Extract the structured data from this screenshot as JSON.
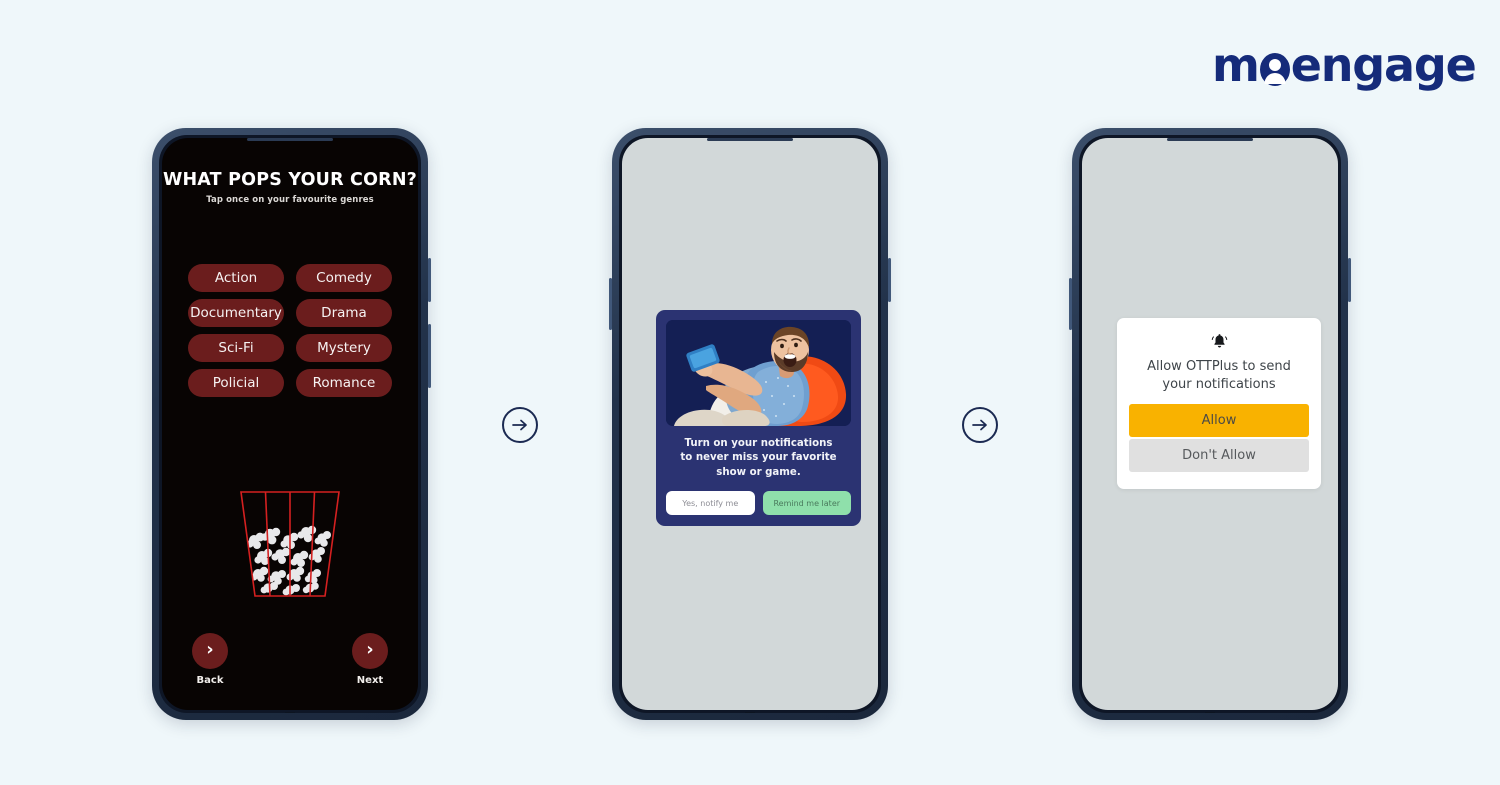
{
  "brand": {
    "logo_text_1": "m",
    "logo_avatar_icon": "person-avatar-o",
    "logo_text_2": "engage",
    "logo_color": "#152b7a",
    "page_background": "#eff7fa"
  },
  "flow": {
    "arrows": [
      {
        "name": "arrow-step-1-to-2",
        "icon": "arrow-right-circle-icon"
      },
      {
        "name": "arrow-step-2-to-3",
        "icon": "arrow-right-circle-icon"
      }
    ]
  },
  "screens": [
    {
      "id": "genre-selection",
      "background": "#080403",
      "title": "WHAT POPS YOUR CORN?",
      "subtitle": "Tap once on your favourite genres",
      "genres": [
        "Action",
        "Comedy",
        "Documentary",
        "Drama",
        "Sci-Fi",
        "Mystery",
        "Policial",
        "Romance"
      ],
      "genre_chip_color": "#6b1d1d",
      "illustration": "popcorn-bucket-illustration",
      "illustration_outline_color": "#d42020",
      "nav": {
        "back_label": "Back",
        "back_icon": "chevron-right-icon",
        "next_label": "Next",
        "next_icon": "chevron-right-icon",
        "circle_color": "#6b1d1d"
      }
    },
    {
      "id": "notification-optin",
      "background": "#d2d8d9",
      "card": {
        "background": "#2b3372",
        "image": "man-on-orange-beanbag-with-phone",
        "image_background": "#141f54",
        "message": "Turn on your notifications to never miss your favorite show or game.",
        "message_lines": [
          "Turn on your notifications",
          "to never miss your favorite",
          "show or game."
        ],
        "buttons": [
          {
            "label": "Yes, notify me",
            "background": "#ffffff",
            "color": "#8d8d95"
          },
          {
            "label": "Remind me later",
            "background": "#8fe0ab",
            "color": "#4a7b5d"
          }
        ]
      }
    },
    {
      "id": "os-permission-prompt",
      "background": "#d2d8d9",
      "dialog": {
        "background": "#ffffff",
        "icon": "bell-ringing-icon",
        "title": "Allow OTTPlus to send your notifications",
        "title_lines": [
          "Allow OTTPlus to send",
          "your notifications"
        ],
        "buttons": [
          {
            "label": "Allow",
            "background": "#f9b200",
            "color": "#4b4a45"
          },
          {
            "label": "Don't Allow",
            "background": "#e0e0e0",
            "color": "#56595c"
          }
        ]
      }
    }
  ]
}
